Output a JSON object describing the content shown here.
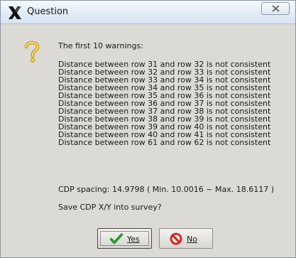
{
  "window": {
    "title": "Question",
    "app_icon": "x-logo-icon",
    "close_icon": "close-icon"
  },
  "message": {
    "icon": "question-icon",
    "heading": "The first 10 warnings:",
    "warnings": [
      "Distance between row 31 and row 32 is not consistent",
      "Distance between row 32 and row 33 is not consistent",
      "Distance between row 33 and row 34 is not consistent",
      "Distance between row 34 and row 35 is not consistent",
      "Distance between row 35 and row 36 is not consistent",
      "Distance between row 36 and row 37 is not consistent",
      "Distance between row 37 and row 38 is not consistent",
      "Distance between row 38 and row 39 is not consistent",
      "Distance between row 39 and row 40 is not consistent",
      "Distance between row 40 and row 41 is not consistent",
      "Distance between row 61 and row 62 is not consistent"
    ],
    "spacing": "CDP spacing: 14.9798 ( Min. 10.0016 ~ Max. 18.6117 )",
    "prompt": "Save CDP X/Y into survey?"
  },
  "buttons": {
    "yes": {
      "label": "Yes",
      "icon": "check-icon"
    },
    "no": {
      "label": "No",
      "icon": "no-entry-icon"
    }
  },
  "colors": {
    "dialog_bg": "#dcdad5",
    "check_green": "#2f9a2a",
    "no_red": "#d21f1f"
  }
}
